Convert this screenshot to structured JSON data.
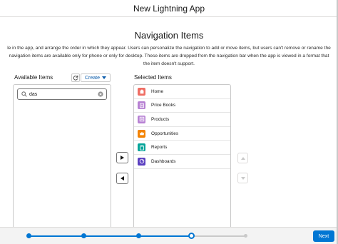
{
  "header": {
    "title": "New Lightning App"
  },
  "section": {
    "title": "Navigation Items",
    "description_lines": [
      "le in the app, and arrange the order in which they appear. Users can personalize the navigation to add or move items, but users can't remove or rename the",
      "navigation items are available only for phone or only for desktop. These items are dropped from the navigation bar when the app is viewed in a format that",
      "the item doesn't support."
    ]
  },
  "available": {
    "label": "Available Items",
    "create_label": "Create",
    "search": {
      "value": "das",
      "placeholder": ""
    }
  },
  "selected": {
    "label": "Selected Items",
    "items": [
      {
        "label": "Home",
        "icon": "home-icon",
        "color": "#ef6e64"
      },
      {
        "label": "Price Books",
        "icon": "price-book-icon",
        "color": "#b781d3"
      },
      {
        "label": "Products",
        "icon": "product-icon",
        "color": "#b781d3"
      },
      {
        "label": "Opportunities",
        "icon": "crown-icon",
        "color": "#fcb95b"
      },
      {
        "label": "Reports",
        "icon": "report-icon",
        "color": "#2e844a"
      },
      {
        "label": "Dashboards",
        "icon": "dashboard-icon",
        "color": "#8a6ad9"
      }
    ]
  },
  "footer": {
    "next_label": "Next",
    "steps_total": 5,
    "current_step": 4
  },
  "colors": {
    "brand": "#0176d3",
    "border": "#c9c9c9"
  }
}
